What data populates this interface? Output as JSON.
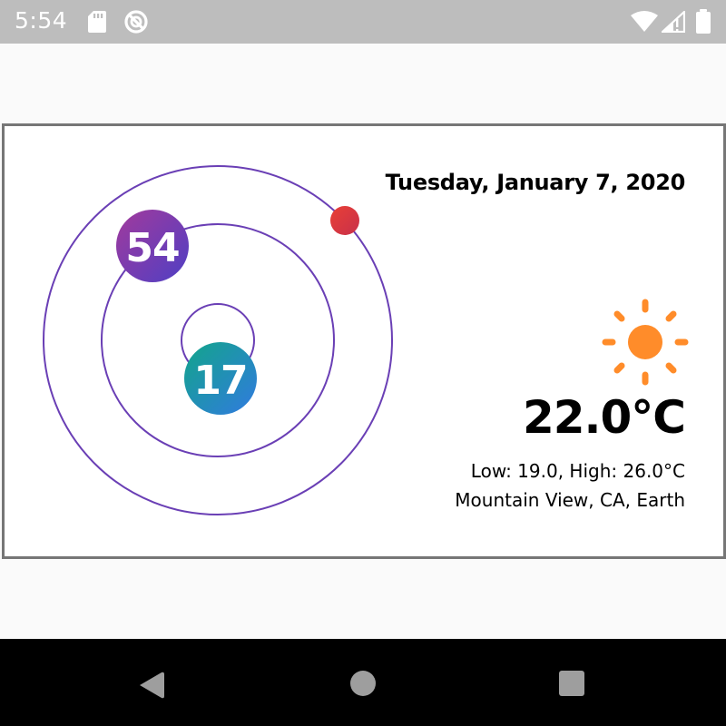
{
  "status_bar": {
    "time": "5:54",
    "left_icons": [
      "sd-card-icon",
      "sync-disabled-icon"
    ],
    "right_icons": [
      "wifi-icon",
      "cell-signal-icon",
      "battery-icon"
    ],
    "background": "#bdbdbd"
  },
  "clock": {
    "hour_value": "17",
    "minute_value": "54",
    "hour_gradient": [
      "#14a08a",
      "#2f7fd8"
    ],
    "minute_gradient": [
      "#8e3fa8",
      "#5a3fbf"
    ],
    "second_dot_color": "#e0353c",
    "orbit_color": "#6a3fb5"
  },
  "date": "Tuesday, January 7, 2020",
  "weather": {
    "icon": "sun-icon",
    "icon_color": "#ff8c2a",
    "temperature": "22.0°C",
    "low_high": "Low: 19.0, High: 26.0°C",
    "location": "Mountain View, CA, Earth"
  },
  "nav_bar": {
    "buttons": [
      "back-button",
      "home-button",
      "recents-button"
    ]
  }
}
